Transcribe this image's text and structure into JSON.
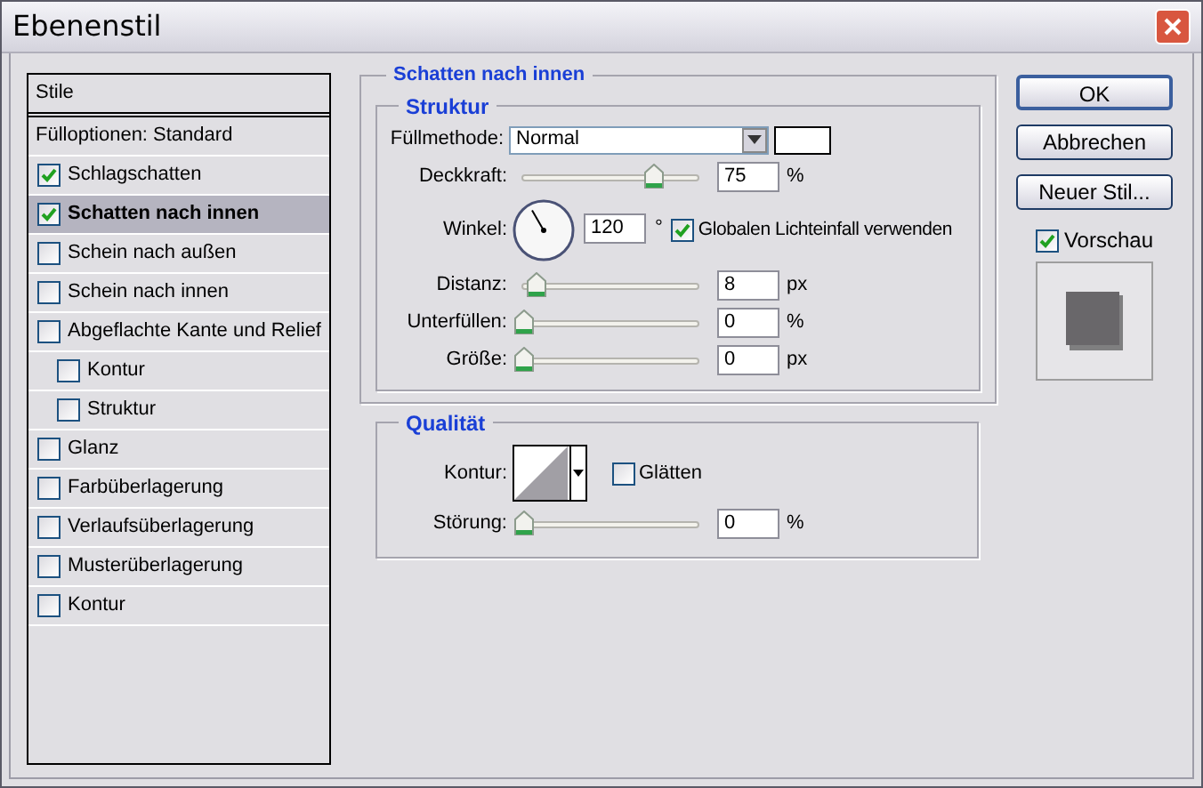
{
  "window": {
    "title": "Ebenenstil"
  },
  "styles": {
    "header": "Stile",
    "blend_options": "Fülloptionen: Standard",
    "items": [
      {
        "label": "Schlagschatten",
        "checked": true,
        "selected": false
      },
      {
        "label": "Schatten nach innen",
        "checked": true,
        "selected": true
      },
      {
        "label": "Schein nach außen",
        "checked": false,
        "selected": false
      },
      {
        "label": "Schein nach innen",
        "checked": false,
        "selected": false
      },
      {
        "label": "Abgeflachte Kante und Relief",
        "checked": false,
        "selected": false,
        "children": [
          {
            "label": "Kontur",
            "checked": false,
            "selected": false
          },
          {
            "label": "Struktur",
            "checked": false,
            "selected": false
          }
        ]
      },
      {
        "label": "Glanz",
        "checked": false,
        "selected": false
      },
      {
        "label": "Farbüberlagerung",
        "checked": false,
        "selected": false
      },
      {
        "label": "Verlaufsüberlagerung",
        "checked": false,
        "selected": false
      },
      {
        "label": "Musterüberlagerung",
        "checked": false,
        "selected": false
      },
      {
        "label": "Kontur",
        "checked": false,
        "selected": false
      }
    ]
  },
  "panel": {
    "title": "Schatten nach innen",
    "structure": {
      "title": "Struktur",
      "rows": [
        {
          "kind": "blend",
          "label": "Füllmethode:",
          "value": "Normal",
          "color": "#ffffff"
        },
        {
          "kind": "slider",
          "label": "Deckkraft:",
          "level": 0.75,
          "value": "75",
          "unit": "%"
        },
        {
          "kind": "angle",
          "label": "Winkel:",
          "value": "120",
          "unit": "°",
          "global_light": {
            "label": "Globalen Lichteinfall verwenden",
            "checked": true
          }
        },
        {
          "kind": "slider",
          "label": "Distanz:",
          "level": 0.07,
          "value": "8",
          "unit": "px"
        },
        {
          "kind": "slider",
          "label": "Unterfüllen:",
          "level": 0,
          "value": "0",
          "unit": "%"
        },
        {
          "kind": "slider",
          "label": "Größe:",
          "level": 0,
          "value": "0",
          "unit": "px"
        }
      ]
    },
    "quality": {
      "title": "Qualität",
      "rows": [
        {
          "kind": "contour",
          "label": "Kontur:",
          "anti_alias": {
            "label": "Glätten",
            "checked": false
          }
        },
        {
          "kind": "slider",
          "label": "Störung:",
          "level": 0,
          "value": "0",
          "unit": "%"
        }
      ]
    }
  },
  "buttons": [
    {
      "label": "OK",
      "default": true
    },
    {
      "label": "Abbrechen",
      "default": false
    },
    {
      "label": "Neuer Stil...",
      "default": false
    }
  ],
  "preview": {
    "label": "Vorschau",
    "checked": true
  }
}
